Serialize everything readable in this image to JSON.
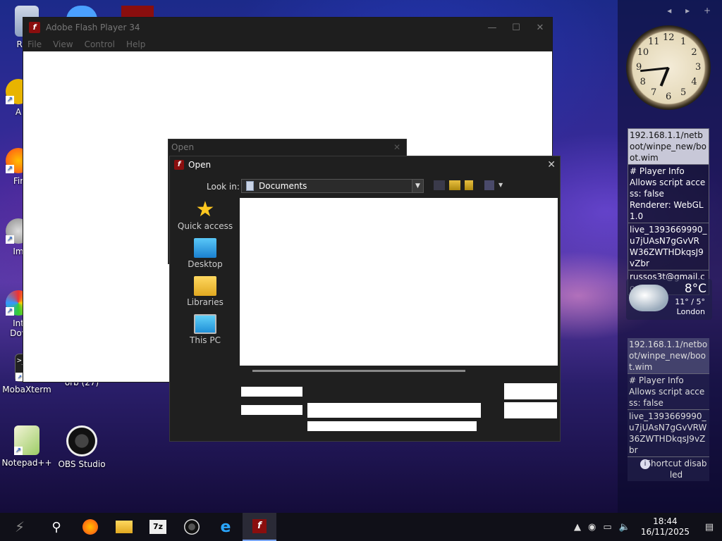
{
  "desktop": {
    "icons_left": [
      {
        "label": "Recy",
        "icon": "recycle-bin-icon"
      },
      {
        "label": "A",
        "icon": "acrobat-icon"
      },
      {
        "label": "Fir",
        "icon": "firefox-icon"
      },
      {
        "label": "Im",
        "icon": "image-viewer-icon"
      },
      {
        "label": "Int\nDov",
        "icon": "internet-download-icon"
      },
      {
        "label": "MobaXterm",
        "icon": "terminal-icon"
      },
      {
        "label": "Notepad++",
        "icon": "notepad-icon"
      }
    ],
    "icons_col2": [
      {
        "label": "orb (27)",
        "icon": "orb-icon"
      },
      {
        "label": "OBS Studio",
        "icon": "obs-icon"
      }
    ]
  },
  "side_panel": {
    "nav": "◂ ▸ +",
    "clock_numbers": [
      "12",
      "1",
      "2",
      "3",
      "4",
      "5",
      "6",
      "7",
      "8",
      "9",
      "10",
      "11"
    ],
    "info_box_1": {
      "url": "192.168.1.1/netboot/winpe_new/boot.wim",
      "player_info": "# Player Info",
      "script_access": "Allows script access: false",
      "renderer": "Renderer: WebGL 1.0",
      "token": "live_1393669990_u7jUAsN7gGvVRW36ZWTHDkqsJ9vZbr",
      "email": "russos3t@gmail.com"
    },
    "weather": {
      "temp": "8°C",
      "range": "11° / 5°",
      "city": "London"
    },
    "info_box_2": {
      "url": "192.168.1.1/netboot/winpe_new/boot.wim",
      "player_info": "# Player Info",
      "script_access": "Allows script access: false",
      "token": "live_1393669990_u7jUAsN7gGvVRW36ZWTHDkqsJ9vZbr",
      "shortcut": "Shortcut disabled"
    }
  },
  "flash_window": {
    "title": "Adobe Flash Player 34",
    "menu": [
      "File",
      "View",
      "Control",
      "Help"
    ]
  },
  "open_dialog_back": {
    "title": "Open"
  },
  "open_dialog": {
    "title": "Open",
    "look_in_label": "Look in:",
    "look_in_value": "Documents",
    "places": [
      "Quick access",
      "Desktop",
      "Libraries",
      "This PC"
    ]
  },
  "taskbar": {
    "time": "18:44",
    "date": "16/11/2025"
  },
  "colors": {
    "accent": "#7aa6ff",
    "flash_red": "#8a0e0e",
    "dialog_bg": "#1f1f1f"
  }
}
